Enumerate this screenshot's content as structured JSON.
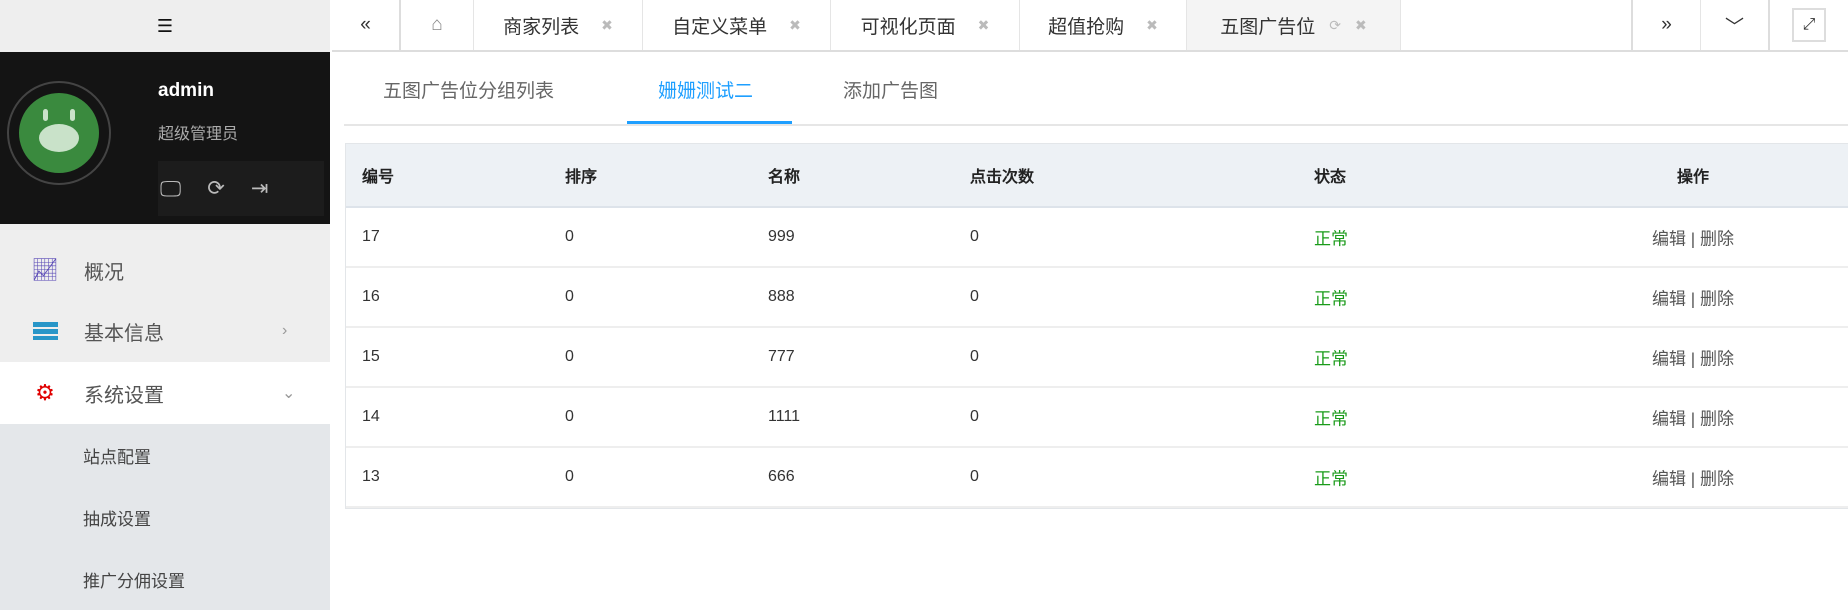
{
  "sidebar": {
    "user": {
      "name": "admin",
      "role": "超级管理员"
    },
    "menu": [
      {
        "label": "概况",
        "icon": "chart-line-icon",
        "color": "#5b4bb7"
      },
      {
        "label": "基本信息",
        "icon": "server-icon",
        "color": "#2896c8"
      },
      {
        "label": "系统设置",
        "icon": "gear-icon",
        "color": "#e00000"
      }
    ],
    "submenu": [
      "站点配置",
      "抽成设置",
      "推广分佣设置"
    ]
  },
  "tabs": [
    "商家列表",
    "自定义菜单",
    "可视化页面",
    "超值抢购",
    "五图广告位"
  ],
  "subtabs": [
    "五图广告位分组列表",
    "姗姗测试二",
    "添加广告图"
  ],
  "table": {
    "headers": [
      "编号",
      "排序",
      "名称",
      "点击次数",
      "状态",
      "操作"
    ],
    "rows": [
      {
        "id": "17",
        "sort": "0",
        "name": "999",
        "clicks": "0",
        "status": "正常"
      },
      {
        "id": "16",
        "sort": "0",
        "name": "888",
        "clicks": "0",
        "status": "正常"
      },
      {
        "id": "15",
        "sort": "0",
        "name": "777",
        "clicks": "0",
        "status": "正常"
      },
      {
        "id": "14",
        "sort": "0",
        "name": "1111",
        "clicks": "0",
        "status": "正常"
      },
      {
        "id": "13",
        "sort": "0",
        "name": "666",
        "clicks": "0",
        "status": "正常"
      }
    ],
    "edit": "编辑",
    "sep": "|",
    "del": "删除"
  }
}
